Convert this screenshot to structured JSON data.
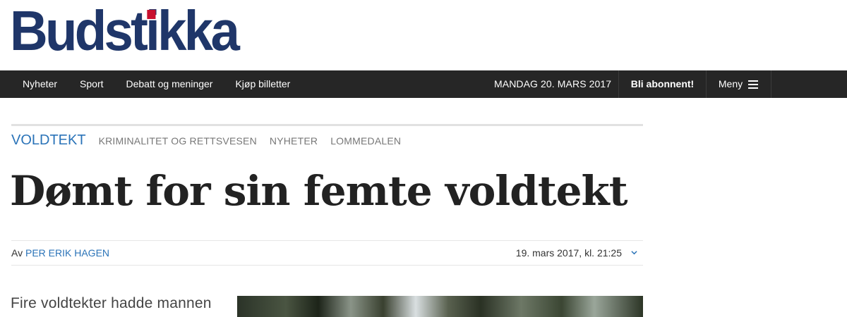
{
  "site": {
    "logo_text": "Budstikka",
    "brand_color": "#1f3669",
    "accent_color": "#c8102e"
  },
  "nav": {
    "items": [
      {
        "label": "Nyheter"
      },
      {
        "label": "Sport"
      },
      {
        "label": "Debatt og meninger"
      },
      {
        "label": "Kjøp billetter"
      }
    ],
    "date": "MANDAG 20. MARS 2017",
    "subscribe_label": "Bli abonnent!",
    "menu_label": "Meny",
    "menu_icon": "hamburger-icon"
  },
  "article": {
    "tags": {
      "main": "VOLDTEKT",
      "others": [
        "KRIMINALITET OG RETTSVESEN",
        "NYHETER",
        "LOMMEDALEN"
      ]
    },
    "headline": "Dømt for sin femte voldtekt",
    "byline_prefix": "Av",
    "author": "PER ERIK HAGEN",
    "timestamp": "19. mars 2017, kl. 21:25",
    "lead_text": "Fire voldtekter hadde mannen"
  }
}
